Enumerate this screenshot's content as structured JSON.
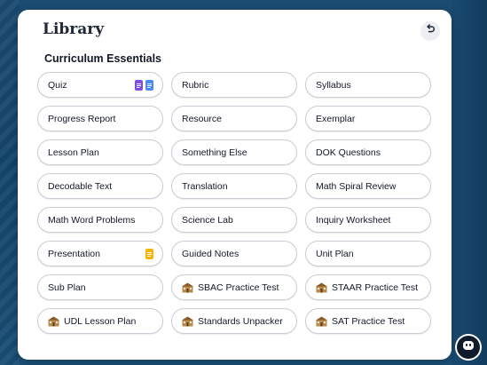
{
  "library": {
    "title": "Library",
    "section_title": "Curriculum Essentials"
  },
  "items": [
    {
      "label": "Quiz",
      "icons": [
        "doc-purple-icon",
        "doc-blue-icon"
      ]
    },
    {
      "label": "Rubric"
    },
    {
      "label": "Syllabus"
    },
    {
      "label": "Progress Report"
    },
    {
      "label": "Resource"
    },
    {
      "label": "Exemplar"
    },
    {
      "label": "Lesson Plan"
    },
    {
      "label": "Something Else"
    },
    {
      "label": "DOK Questions"
    },
    {
      "label": "Decodable Text"
    },
    {
      "label": "Translation"
    },
    {
      "label": "Math Spiral Review"
    },
    {
      "label": "Math Word Problems"
    },
    {
      "label": "Science Lab"
    },
    {
      "label": "Inquiry Worksheet"
    },
    {
      "label": "Presentation",
      "icons": [
        "doc-yellow-icon"
      ]
    },
    {
      "label": "Guided Notes"
    },
    {
      "label": "Unit Plan"
    },
    {
      "label": "Sub Plan"
    },
    {
      "label": "SBAC Practice Test",
      "prefix_icon": "school-icon"
    },
    {
      "label": "STAAR Practice Test",
      "prefix_icon": "school-icon"
    },
    {
      "label": "UDL Lesson Plan",
      "prefix_icon": "school-icon"
    },
    {
      "label": "Standards Unpacker",
      "prefix_icon": "school-icon"
    },
    {
      "label": "SAT Practice Test",
      "prefix_icon": "school-icon"
    }
  ],
  "colors": {
    "background": "#15476b",
    "panel": "#ffffff",
    "doc_purple": "#7c4dde",
    "doc_blue": "#4a8af4",
    "doc_yellow": "#f4b400"
  }
}
